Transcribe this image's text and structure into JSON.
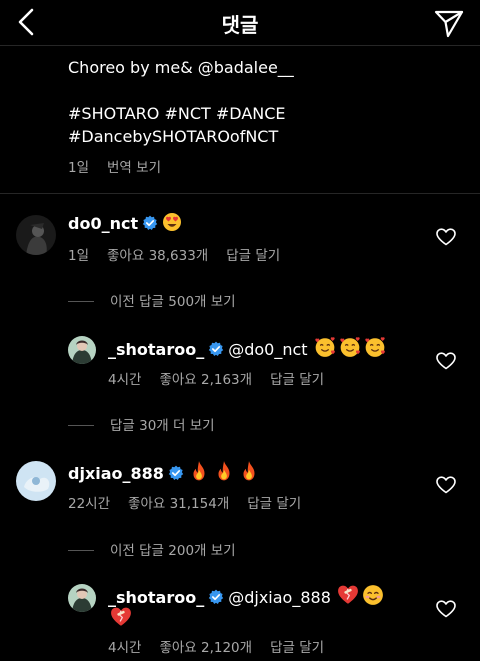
{
  "header": {
    "title": "댓글"
  },
  "caption": {
    "line1": "Choreo by me& @badalee__",
    "line2": "#SHOTARO #NCT #DANCE",
    "line3": "#DancebySHOTAROofNCT",
    "time": "1일",
    "translate": "번역 보기"
  },
  "comments": [
    {
      "username": "do0_nct",
      "text": "",
      "time": "1일",
      "likes": "좋아요 38,633개",
      "reply": "답글 달기",
      "view_replies": "이전 답글 500개 보기"
    },
    {
      "username": "_shotaroo_",
      "mention": "@do0_nct",
      "time": "4시간",
      "likes": "좋아요 2,163개",
      "reply": "답글 달기",
      "view_replies": "답글 30개 더 보기"
    },
    {
      "username": "djxiao_888",
      "time": "22시간",
      "likes": "좋아요 31,154개",
      "reply": "답글 달기",
      "view_replies": "이전 답글 200개 보기"
    },
    {
      "username": "_shotaroo_",
      "mention": "@djxiao_888",
      "time": "4시간",
      "likes": "좋아요 2,120개",
      "reply": "답글 달기"
    }
  ],
  "icons": {
    "back": "back-icon",
    "send": "send-icon",
    "heart": "heart-icon",
    "verified": "verified-badge-icon"
  },
  "colors": {
    "background": "#000000",
    "verified": "#3897f0",
    "meta": "#a8a8a8",
    "divider": "#262626"
  }
}
